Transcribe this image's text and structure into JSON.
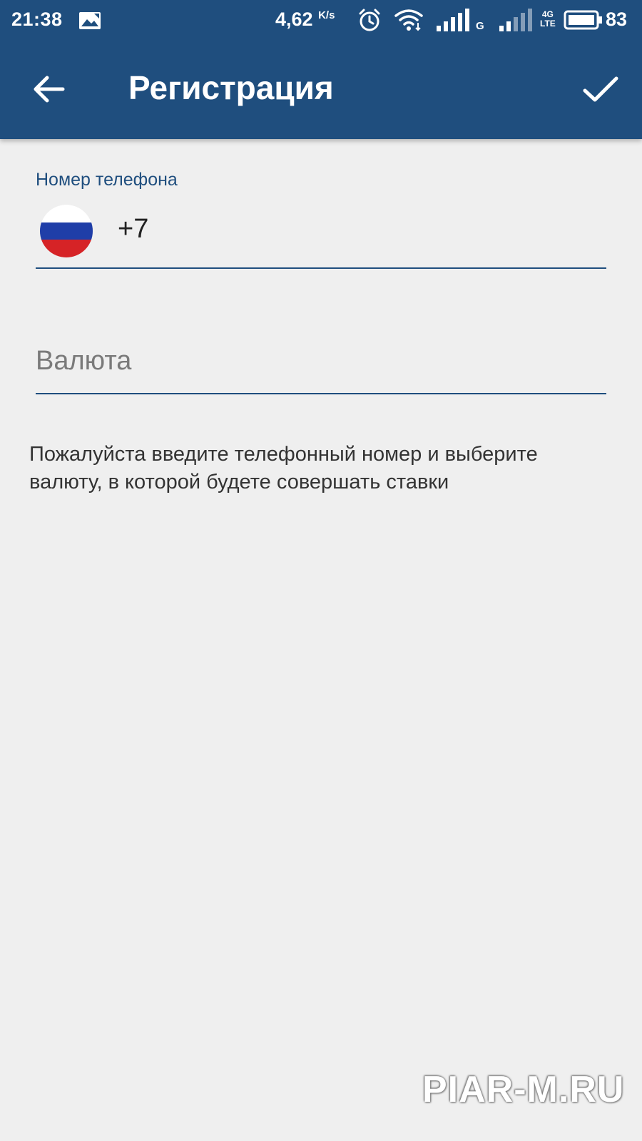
{
  "status_bar": {
    "time": "21:38",
    "net_speed": "4,62",
    "net_speed_unit": "K/s",
    "network_g": "G",
    "network_4g": "4G",
    "network_lte": "LTE",
    "battery": "83",
    "icons": [
      "image-notification-icon",
      "alarm-icon",
      "wifi-icon",
      "signal-icon",
      "signal-icon-2",
      "battery-icon"
    ]
  },
  "app_bar": {
    "title": "Регистрация",
    "icons": [
      "back-arrow-icon",
      "check-icon"
    ],
    "color": "#1f4e7e"
  },
  "form": {
    "phone": {
      "label": "Номер телефона",
      "value": "+7",
      "country_flag": "russia-flag-icon"
    },
    "currency": {
      "placeholder": "Валюта"
    },
    "hint": "Пожалуйста введите телефонный номер и выберите валюту, в которой будете совершать ставки"
  },
  "watermark": "PIAR-M.RU"
}
